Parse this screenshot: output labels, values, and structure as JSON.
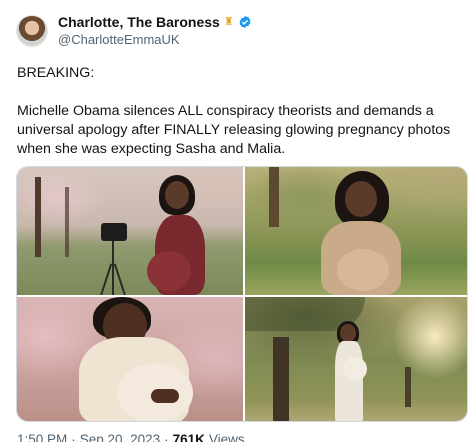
{
  "author": {
    "display_name": "Charlotte, The Baroness",
    "emoji_icon": "crown-icon",
    "verified": true,
    "handle": "@CharlotteEmmaUK"
  },
  "tweet": {
    "line1": "BREAKING:",
    "line2": "Michelle Obama silences ALL conspiracy theorists and demands a universal apology after FINALLY releasing glowing pregnancy photos when she was expecting Sasha and Malia."
  },
  "media": {
    "count": 4,
    "photos": [
      "photo-1",
      "photo-2",
      "photo-3",
      "photo-4"
    ]
  },
  "footer": {
    "time": "1:50 PM",
    "sep": "·",
    "date": "Sep 20, 2023",
    "views_count": "761K",
    "views_label": "Views"
  },
  "colors": {
    "text": "#0f1419",
    "secondary": "#536471",
    "verified": "#1d9bf0",
    "border": "#cfd9de"
  }
}
